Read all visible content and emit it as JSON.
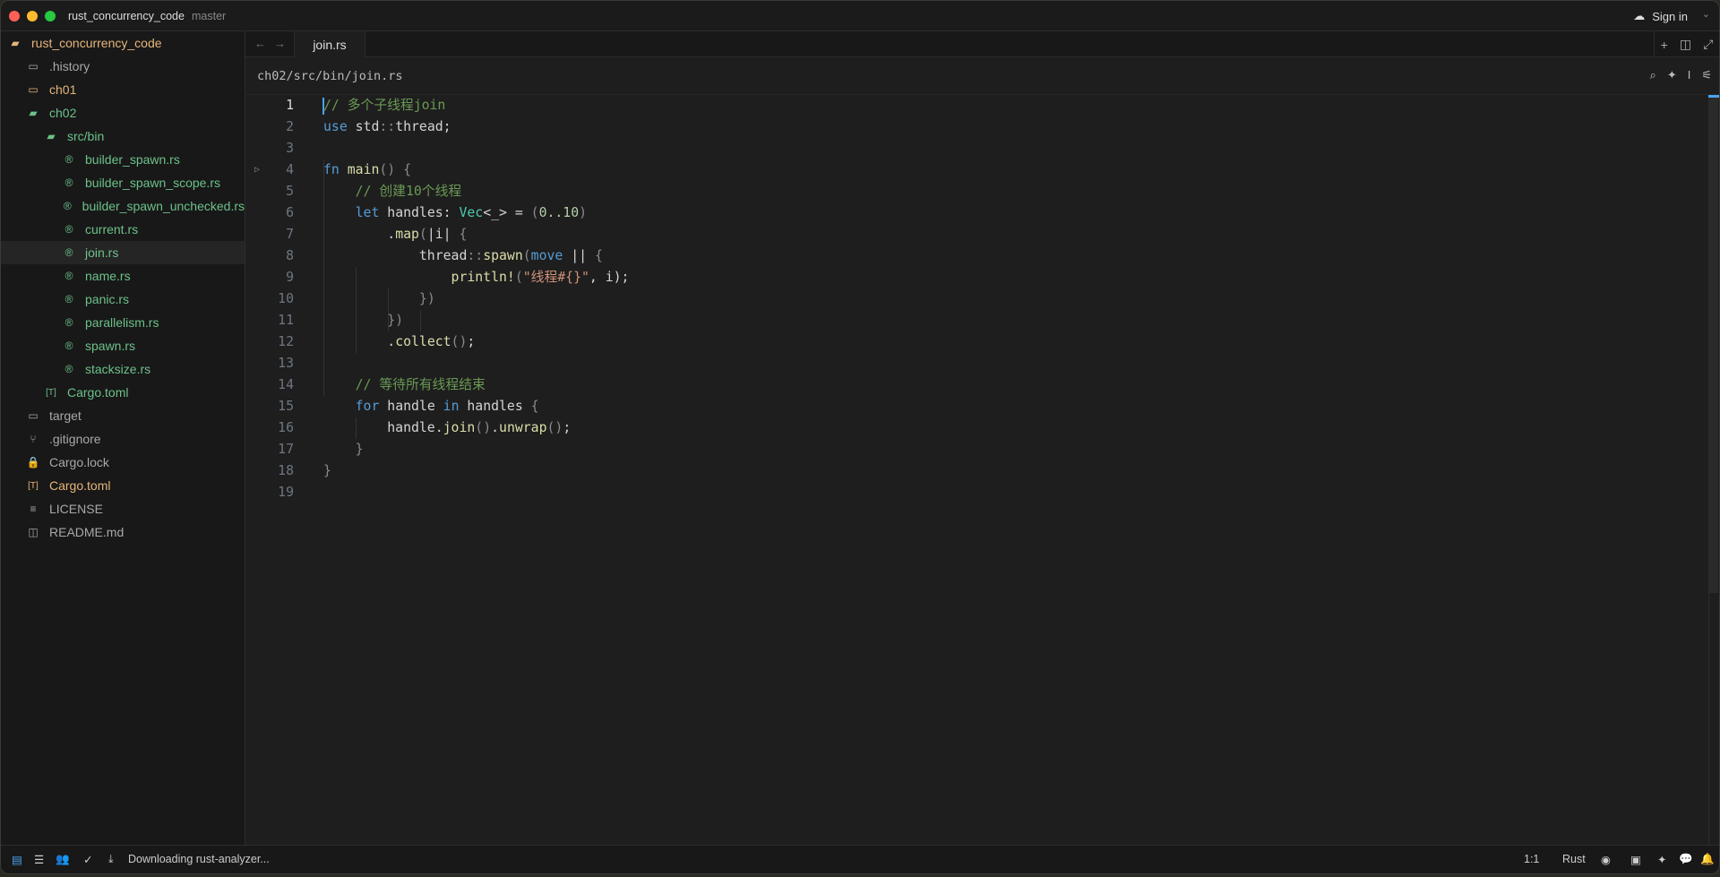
{
  "window": {
    "project": "rust_concurrency_code",
    "branch": "master",
    "sign_in": "Sign in"
  },
  "sidebar": {
    "items": [
      {
        "label": "rust_concurrency_code",
        "icon": "folder-open-icon",
        "color": "y",
        "depth": 0
      },
      {
        "label": ".history",
        "icon": "folder-icon",
        "color": "n",
        "depth": 1
      },
      {
        "label": "ch01",
        "icon": "folder-icon",
        "color": "y",
        "depth": 1
      },
      {
        "label": "ch02",
        "icon": "folder-open-icon",
        "color": "g",
        "depth": 1
      },
      {
        "label": "src/bin",
        "icon": "folder-open-icon",
        "color": "g",
        "depth": 2
      },
      {
        "label": "builder_spawn.rs",
        "icon": "rust-file-icon",
        "color": "g",
        "depth": 3
      },
      {
        "label": "builder_spawn_scope.rs",
        "icon": "rust-file-icon",
        "color": "g",
        "depth": 3
      },
      {
        "label": "builder_spawn_unchecked.rs",
        "icon": "rust-file-icon",
        "color": "g",
        "depth": 3
      },
      {
        "label": "current.rs",
        "icon": "rust-file-icon",
        "color": "g",
        "depth": 3
      },
      {
        "label": "join.rs",
        "icon": "rust-file-icon",
        "color": "g",
        "depth": 3,
        "selected": true
      },
      {
        "label": "name.rs",
        "icon": "rust-file-icon",
        "color": "g",
        "depth": 3
      },
      {
        "label": "panic.rs",
        "icon": "rust-file-icon",
        "color": "g",
        "depth": 3
      },
      {
        "label": "parallelism.rs",
        "icon": "rust-file-icon",
        "color": "g",
        "depth": 3
      },
      {
        "label": "spawn.rs",
        "icon": "rust-file-icon",
        "color": "g",
        "depth": 3
      },
      {
        "label": "stacksize.rs",
        "icon": "rust-file-icon",
        "color": "g",
        "depth": 3
      },
      {
        "label": "Cargo.toml",
        "icon": "toml-file-icon",
        "color": "g",
        "depth": 2
      },
      {
        "label": "target",
        "icon": "folder-icon",
        "color": "n",
        "depth": 1
      },
      {
        "label": ".gitignore",
        "icon": "git-icon",
        "color": "n",
        "depth": 1
      },
      {
        "label": "Cargo.lock",
        "icon": "lock-icon",
        "color": "n",
        "depth": 1
      },
      {
        "label": "Cargo.toml",
        "icon": "toml-file-icon",
        "color": "y",
        "depth": 1
      },
      {
        "label": "LICENSE",
        "icon": "text-file-icon",
        "color": "n",
        "depth": 1
      },
      {
        "label": "README.md",
        "icon": "book-icon",
        "color": "n",
        "depth": 1
      }
    ]
  },
  "tabs": [
    {
      "label": "join.rs",
      "active": true
    }
  ],
  "breadcrumb": "ch02/src/bin/join.rs",
  "editor": {
    "lines": [
      [
        [
          "// 多个子线程join",
          "cm"
        ]
      ],
      [
        [
          "use",
          "k"
        ],
        [
          " std",
          ""
        ],
        [
          "::",
          "p"
        ],
        [
          "thread;",
          ""
        ]
      ],
      [],
      [
        [
          "fn",
          "k"
        ],
        [
          " ",
          ""
        ],
        [
          "main",
          "f"
        ],
        [
          "() {",
          "p"
        ]
      ],
      [
        [
          "    ",
          ""
        ],
        [
          "// 创建10个线程",
          "cm"
        ]
      ],
      [
        [
          "    ",
          ""
        ],
        [
          "let",
          "k"
        ],
        [
          " handles: ",
          ""
        ],
        [
          "Vec",
          "t"
        ],
        [
          "<_> = ",
          ""
        ],
        [
          "(",
          "p"
        ],
        [
          "0..10",
          "nu"
        ],
        [
          ")",
          "p"
        ]
      ],
      [
        [
          "        .",
          ""
        ],
        [
          "map",
          "m"
        ],
        [
          "(",
          "p"
        ],
        [
          "|i| ",
          ""
        ],
        [
          "{",
          "p"
        ]
      ],
      [
        [
          "            thread",
          ""
        ],
        [
          "::",
          "p"
        ],
        [
          "spawn",
          "m"
        ],
        [
          "(",
          "p"
        ],
        [
          "move",
          "k"
        ],
        [
          " || ",
          ""
        ],
        [
          "{",
          "p"
        ]
      ],
      [
        [
          "                ",
          ""
        ],
        [
          "println!",
          "m"
        ],
        [
          "(",
          "p"
        ],
        [
          "\"线程#{}\"",
          "s"
        ],
        [
          ", i",
          ""
        ],
        [
          ");",
          ""
        ]
      ],
      [
        [
          "            ",
          ""
        ],
        [
          "})",
          "p"
        ]
      ],
      [
        [
          "        ",
          ""
        ],
        [
          "})",
          "p"
        ]
      ],
      [
        [
          "        .",
          ""
        ],
        [
          "collect",
          "m"
        ],
        [
          "()",
          "p"
        ],
        [
          ";",
          ""
        ]
      ],
      [],
      [
        [
          "    ",
          ""
        ],
        [
          "// 等待所有线程结束",
          "cm"
        ]
      ],
      [
        [
          "    ",
          ""
        ],
        [
          "for",
          "k"
        ],
        [
          " handle ",
          ""
        ],
        [
          "in",
          "k"
        ],
        [
          " handles ",
          ""
        ],
        [
          "{",
          "p"
        ]
      ],
      [
        [
          "        handle.",
          ""
        ],
        [
          "join",
          "m"
        ],
        [
          "()",
          "p"
        ],
        [
          ".",
          ""
        ],
        [
          "unwrap",
          "m"
        ],
        [
          "()",
          "p"
        ],
        [
          ";",
          ""
        ]
      ],
      [
        [
          "    ",
          ""
        ],
        [
          "}",
          "p"
        ]
      ],
      [
        [
          "}",
          "p"
        ]
      ],
      []
    ]
  },
  "status": {
    "message": "Downloading rust-analyzer...",
    "position": "1:1",
    "language": "Rust"
  }
}
